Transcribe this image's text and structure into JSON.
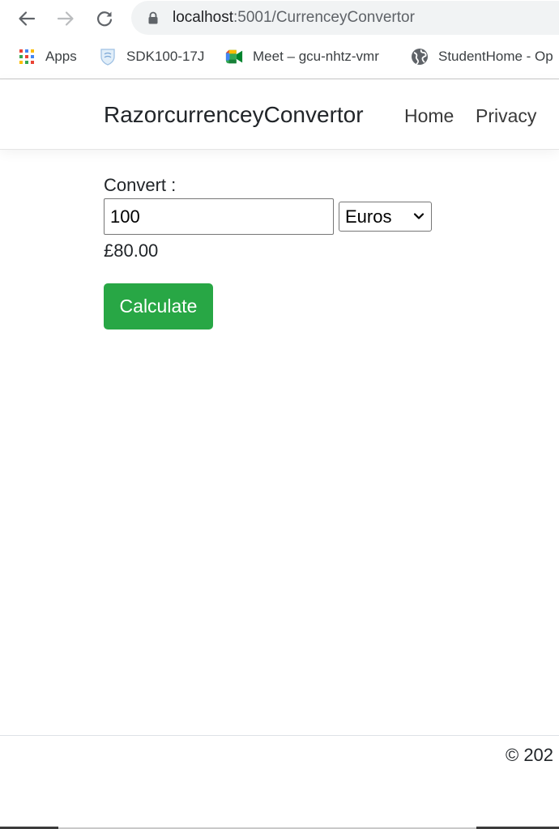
{
  "browser": {
    "url_host": "localhost",
    "url_path": ":5001/CurrenceyConvertor",
    "bookmarks": [
      {
        "label": "Apps",
        "icon": "apps-grid-icon"
      },
      {
        "label": "SDK100-17J",
        "icon": "shield-icon"
      },
      {
        "label": "Meet – gcu-nhtz-vmr",
        "icon": "meet-icon"
      },
      {
        "label": "StudentHome - Op",
        "icon": "globe-icon"
      }
    ]
  },
  "navbar": {
    "brand": "RazorcurrenceyConvertor",
    "links": [
      "Home",
      "Privacy"
    ]
  },
  "form": {
    "convert_label": "Convert :",
    "amount_value": "100",
    "currency_selected": "Euros",
    "result": "£80.00",
    "calculate_label": "Calculate"
  },
  "footer": {
    "text": "© 202"
  },
  "colors": {
    "button_green": "#28a745",
    "omnibox_bg": "#f1f3f4"
  }
}
